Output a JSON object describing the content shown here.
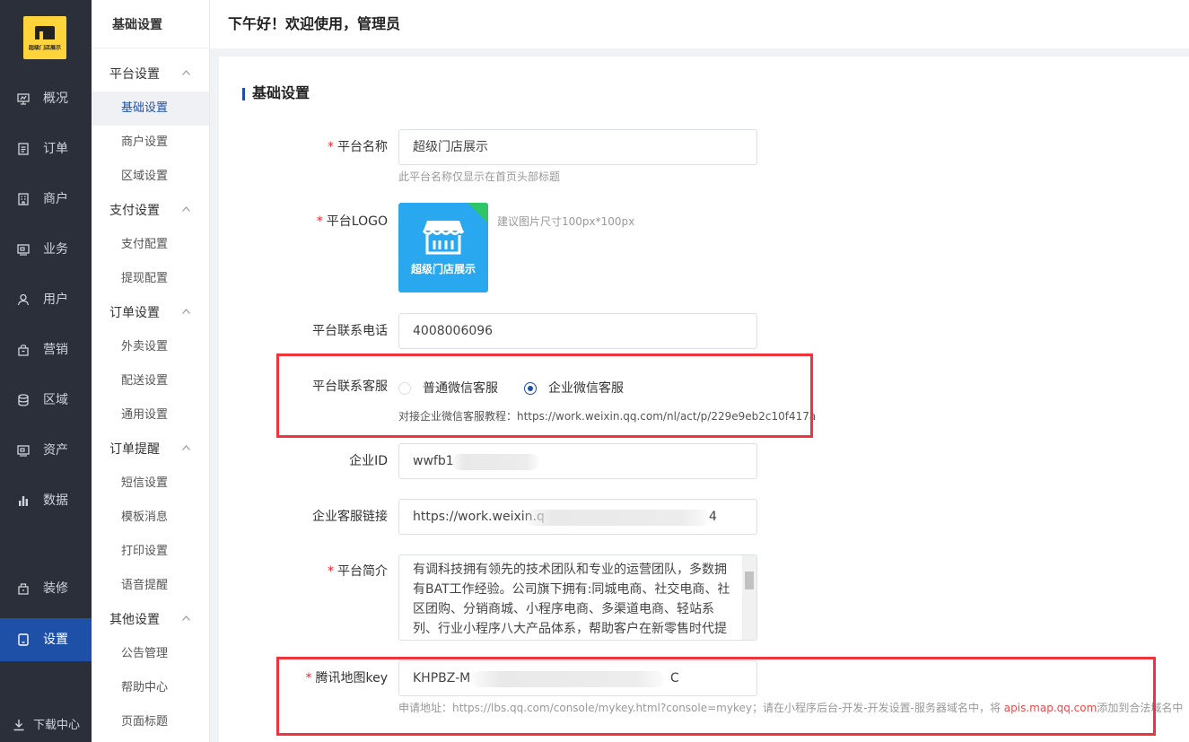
{
  "brand": {
    "logo_caption": "超级门店展示"
  },
  "nav": {
    "items": [
      {
        "label": "概况",
        "icon": "presentation-icon"
      },
      {
        "label": "订单",
        "icon": "order-list-icon"
      },
      {
        "label": "商户",
        "icon": "building-icon"
      },
      {
        "label": "业务",
        "icon": "business-icon"
      },
      {
        "label": "用户",
        "icon": "user-icon"
      },
      {
        "label": "营销",
        "icon": "marketing-icon"
      },
      {
        "label": "区域",
        "icon": "database-icon"
      },
      {
        "label": "资产",
        "icon": "wallet-icon"
      },
      {
        "label": "数据",
        "icon": "bar-chart-icon"
      },
      {
        "label": "装修",
        "icon": "decorate-icon"
      },
      {
        "label": "设置",
        "icon": "settings-icon",
        "active": true
      }
    ],
    "download": "下载中心"
  },
  "submenu": {
    "title": "基础设置",
    "groups": [
      {
        "label": "平台设置",
        "items": [
          "基础设置",
          "商户设置",
          "区域设置"
        ]
      },
      {
        "label": "支付设置",
        "items": [
          "支付配置",
          "提现配置"
        ]
      },
      {
        "label": "订单设置",
        "items": [
          "外卖设置",
          "配送设置",
          "通用设置"
        ]
      },
      {
        "label": "订单提醒",
        "items": [
          "短信设置",
          "模板消息",
          "打印设置",
          "语音提醒"
        ]
      },
      {
        "label": "其他设置",
        "items": [
          "公告管理",
          "帮助中心",
          "页面标题"
        ]
      }
    ],
    "active_item": "基础设置"
  },
  "header": {
    "greeting": "下午好！欢迎使用，管理员"
  },
  "form": {
    "section_title": "基础设置",
    "platform_name": {
      "label": "平台名称",
      "value": "超级门店展示",
      "help": "此平台名称仅显示在首页头部标题"
    },
    "platform_logo": {
      "label": "平台LOGO",
      "image_caption": "超级门店展示",
      "help": "建议图片尺寸100px*100px"
    },
    "phone": {
      "label": "平台联系电话",
      "value": "4008006096"
    },
    "customer_service": {
      "label": "平台联系客服",
      "options": [
        "普通微信客服",
        "企业微信客服"
      ],
      "selected": "企业微信客服",
      "help": "对接企业微信客服教程：https://work.weixin.qq.com/nl/act/p/229e9eb2c10f417a"
    },
    "corp_id": {
      "label": "企业ID",
      "value": "wwfb1"
    },
    "service_link": {
      "label": "企业客服链接",
      "value_prefix": "https://work.weixin.q",
      "value_suffix": "4"
    },
    "intro": {
      "label": "平台简介",
      "value": "有调科技拥有领先的技术团队和专业的运营团队，多数拥有BAT工作经验。公司旗下拥有:同城电商、社交电商、社区团购、分销商城、小程序电商、多渠道电商、轻站系列、行业小程序八大产品体系，帮助客户在新零售时代提供技术支持和专业的运营服务。"
    },
    "map_key": {
      "label": "腾讯地图key",
      "value_prefix": "KHPBZ-M",
      "value_suffix": "C",
      "help_prefix": "申请地址：https://lbs.qq.com/console/mykey.html?console=mykey；请在小程序后台-开发-开发设置-服务器域名中，将 ",
      "help_domain": "apis.map.qq.com",
      "help_suffix": "添加到合法域名中"
    }
  },
  "colors": {
    "primary": "#1f50a8",
    "sidebar": "#2b2f3a",
    "highlight_box": "#f0343c",
    "required": "#f5222d"
  }
}
